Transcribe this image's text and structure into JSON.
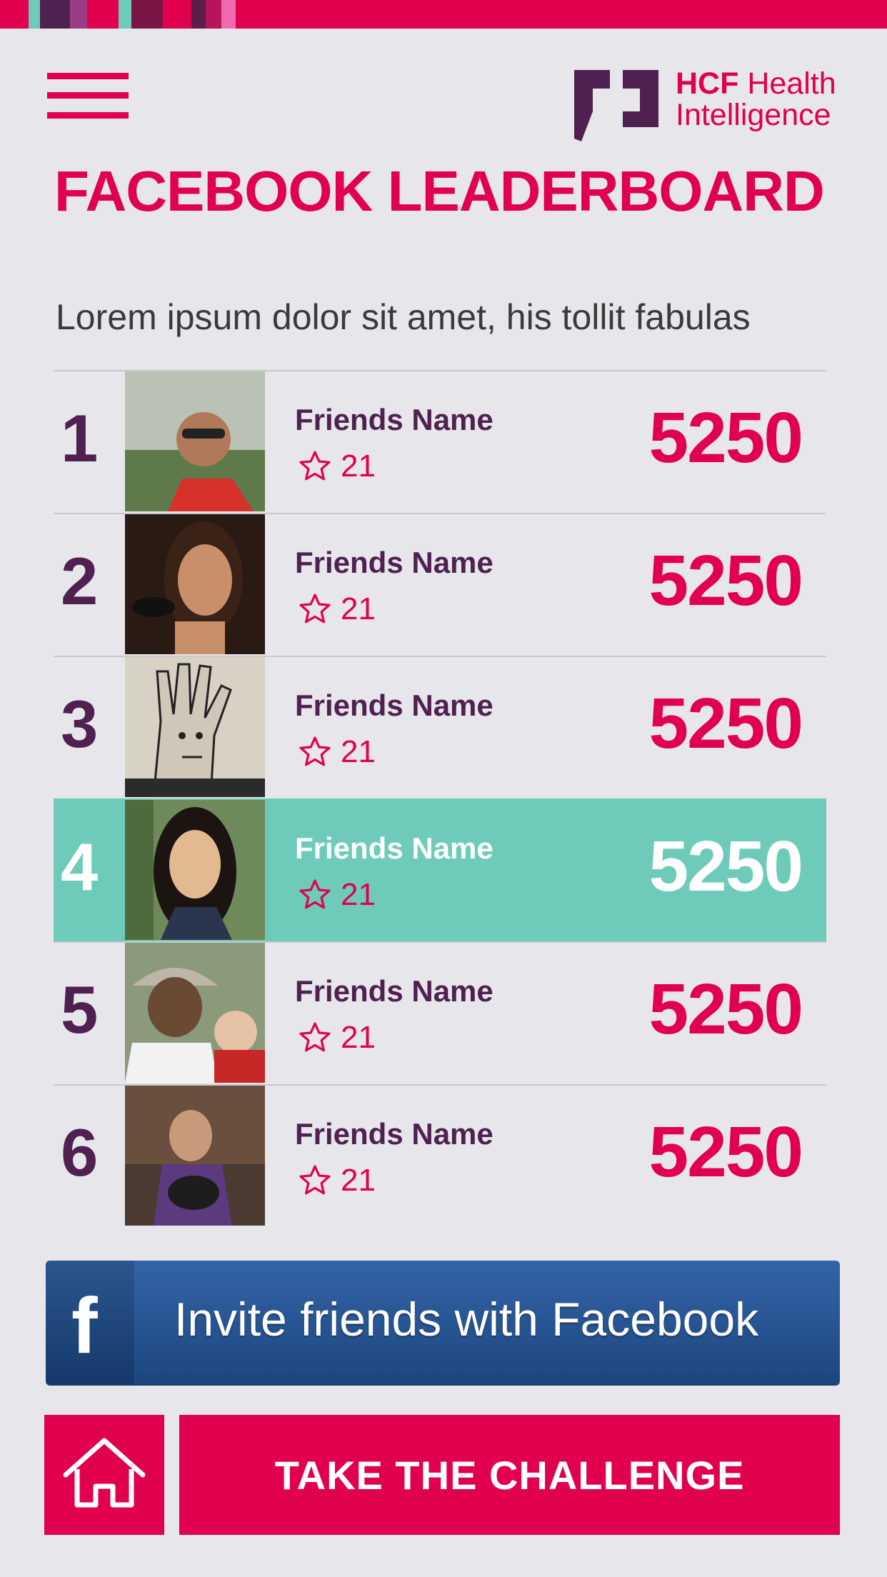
{
  "colors": {
    "accent": "#e0004d",
    "purple": "#4f2150",
    "teal": "#6ecbb9",
    "background": "#e7e6ea",
    "facebook_blue": "#1c467f"
  },
  "logo": {
    "line1_bold": "HCF",
    "line1_rest": " Health",
    "line2": "Intelligence"
  },
  "page": {
    "title": "FACEBOOK LEADERBOARD",
    "subtitle": "Lorem ipsum dolor sit amet, his tollit fabulas"
  },
  "leaderboard": [
    {
      "rank": "1",
      "name": "Friends Name",
      "stars": "21",
      "score": "5250",
      "highlighted": false
    },
    {
      "rank": "2",
      "name": "Friends Name",
      "stars": "21",
      "score": "5250",
      "highlighted": false
    },
    {
      "rank": "3",
      "name": "Friends Name",
      "stars": "21",
      "score": "5250",
      "highlighted": false
    },
    {
      "rank": "4",
      "name": "Friends Name",
      "stars": "21",
      "score": "5250",
      "highlighted": true
    },
    {
      "rank": "5",
      "name": "Friends Name",
      "stars": "21",
      "score": "5250",
      "highlighted": false
    },
    {
      "rank": "6",
      "name": "Friends Name",
      "stars": "21",
      "score": "5250",
      "highlighted": false
    }
  ],
  "buttons": {
    "facebook_icon": "f",
    "invite_label": "Invite friends with Facebook",
    "home_icon": "home-icon",
    "challenge_label": "TAKE THE CHALLENGE"
  }
}
